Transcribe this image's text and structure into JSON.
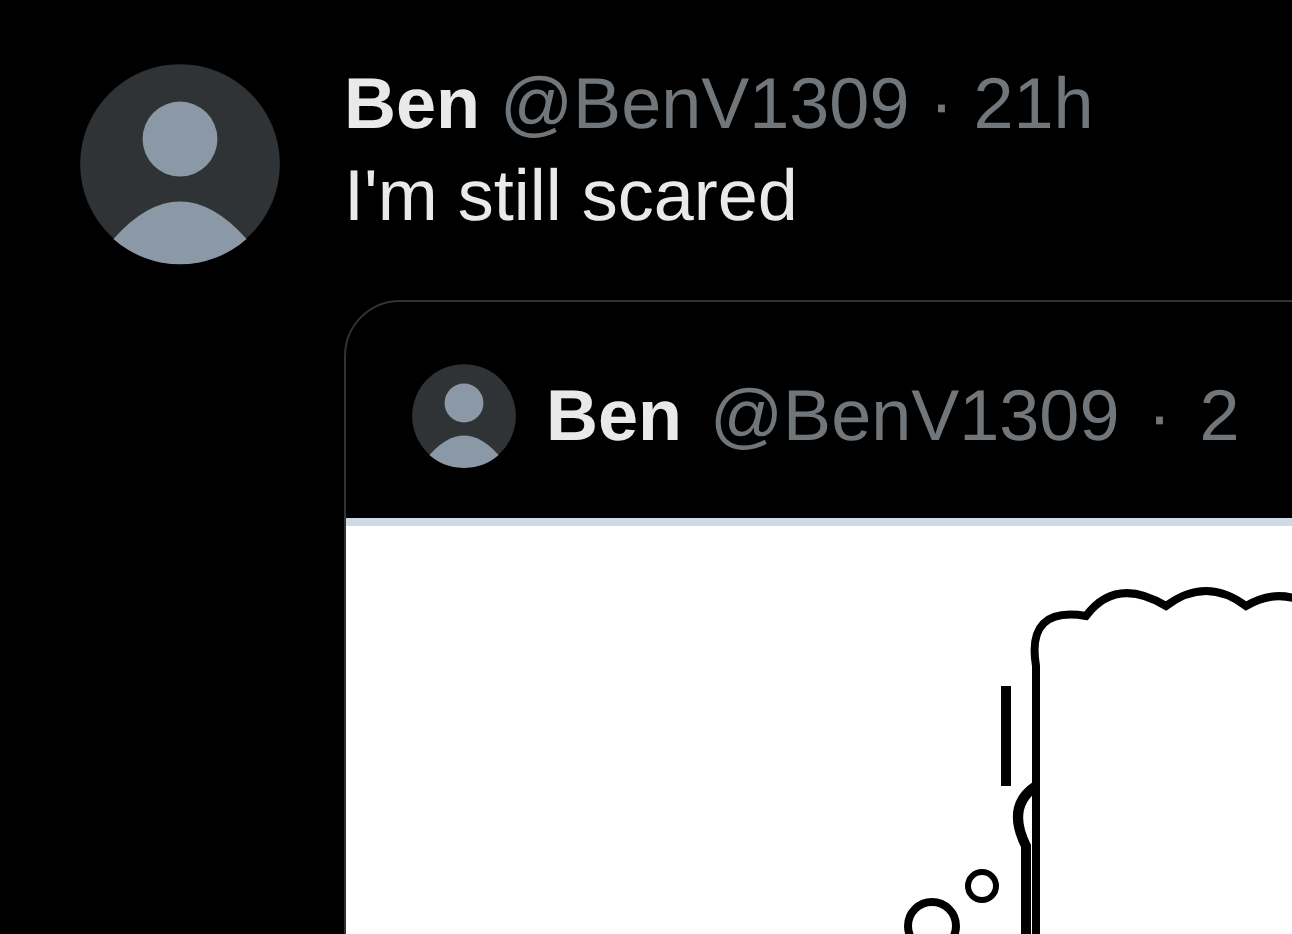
{
  "post": {
    "author": "Ben",
    "handle": "@BenV1309",
    "separator": "·",
    "time": "21h",
    "text": "I'm still scared",
    "quote": {
      "author": "Ben",
      "handle": "@BenV1309",
      "separator": "·",
      "time": "2"
    }
  }
}
